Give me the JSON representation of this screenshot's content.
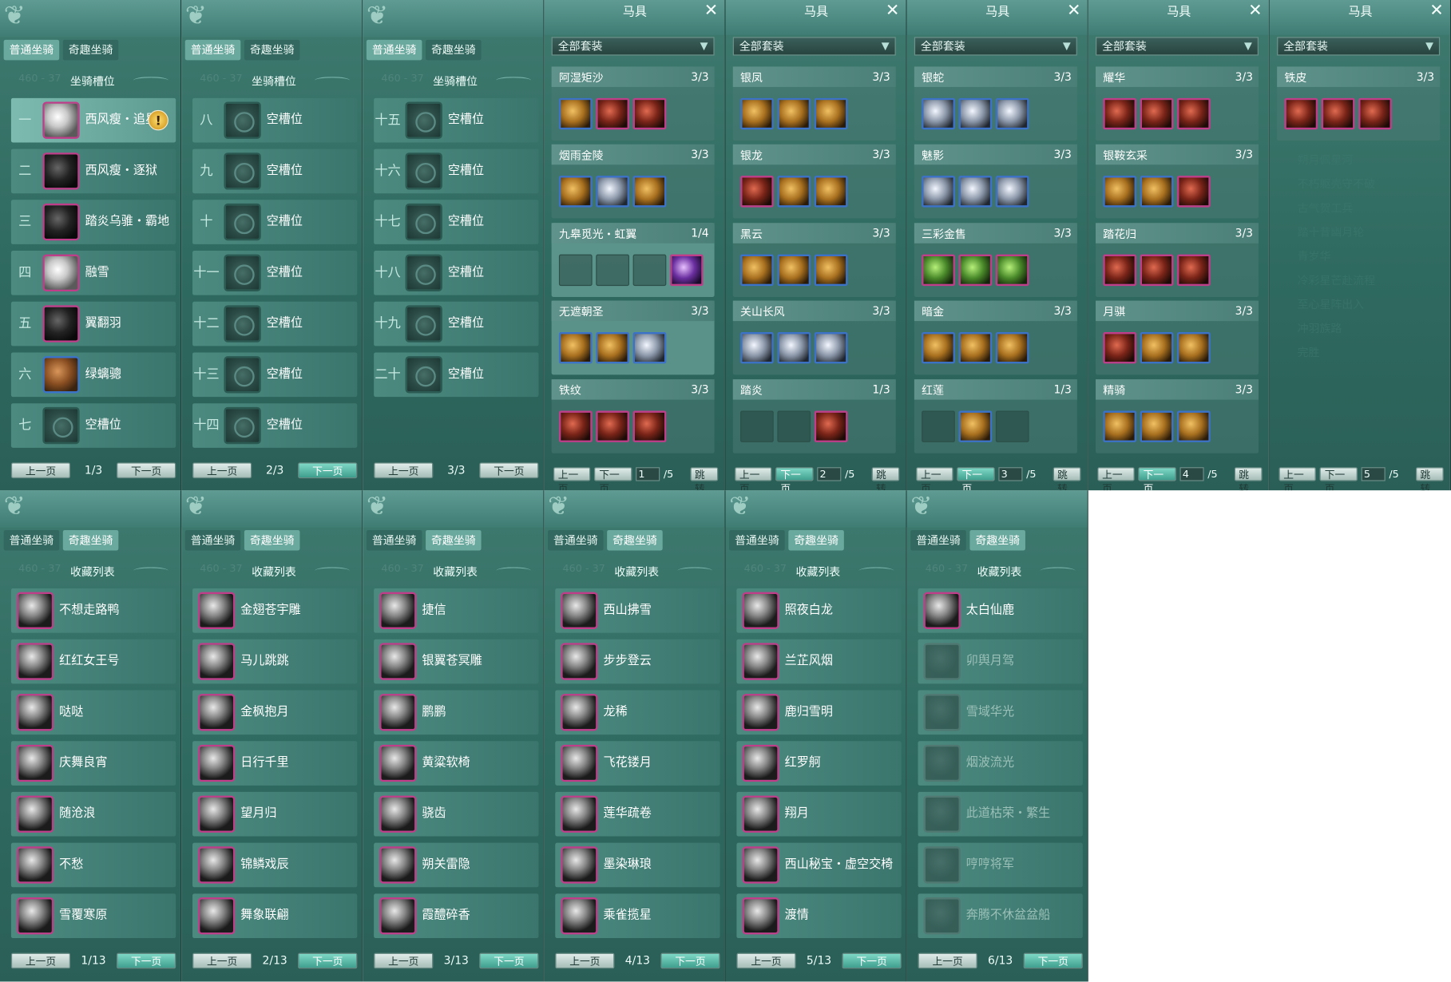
{
  "common": {
    "tab_normal": "普通坐骑",
    "tab_fun": "奇趣坐骑",
    "faint_code": "460 - 37",
    "prev": "上一页",
    "next": "下一页",
    "jump": "跳转"
  },
  "slots_panels": [
    {
      "section": "坐骑槽位",
      "rows": [
        {
          "num": "一",
          "name": "西风瘦・追星",
          "warn": "!"
        },
        {
          "num": "二",
          "name": "西风瘦・逐狱"
        },
        {
          "num": "三",
          "name": "踏炎乌骓・霸地"
        },
        {
          "num": "四",
          "name": "融雪"
        },
        {
          "num": "五",
          "name": "翼翻羽"
        },
        {
          "num": "六",
          "name": "绿螭骢"
        },
        {
          "num": "七",
          "name": "空槽位"
        }
      ],
      "page": "1/3"
    },
    {
      "section": "坐骑槽位",
      "rows": [
        {
          "num": "八",
          "name": "空槽位"
        },
        {
          "num": "九",
          "name": "空槽位"
        },
        {
          "num": "十",
          "name": "空槽位"
        },
        {
          "num": "十一",
          "name": "空槽位"
        },
        {
          "num": "十二",
          "name": "空槽位"
        },
        {
          "num": "十三",
          "name": "空槽位"
        },
        {
          "num": "十四",
          "name": "空槽位"
        }
      ],
      "page": "2/3"
    },
    {
      "section": "坐骑槽位",
      "rows": [
        {
          "num": "十五",
          "name": "空槽位"
        },
        {
          "num": "十六",
          "name": "空槽位"
        },
        {
          "num": "十七",
          "name": "空槽位"
        },
        {
          "num": "十八",
          "name": "空槽位"
        },
        {
          "num": "十九",
          "name": "空槽位"
        },
        {
          "num": "二十",
          "name": "空槽位"
        }
      ],
      "page": "3/3"
    }
  ],
  "gear_panels": [
    {
      "title": "马具",
      "dropdown": "全部套装",
      "page": "1",
      "total": "/5",
      "sets": [
        {
          "name": "阿湿矩沙",
          "count": "3/3"
        },
        {
          "name": "烟雨金陵",
          "count": "3/3"
        },
        {
          "name": "九皋觅光・虹翼",
          "count": "1/4"
        },
        {
          "name": "无遮朝圣",
          "count": "3/3"
        },
        {
          "name": "铁纹",
          "count": "3/3"
        }
      ]
    },
    {
      "title": "马具",
      "dropdown": "全部套装",
      "page": "2",
      "total": "/5",
      "sets": [
        {
          "name": "银凤",
          "count": "3/3"
        },
        {
          "name": "银龙",
          "count": "3/3"
        },
        {
          "name": "黑云",
          "count": "3/3"
        },
        {
          "name": "关山长风",
          "count": "3/3"
        },
        {
          "name": "踏炎",
          "count": "1/3"
        }
      ]
    },
    {
      "title": "马具",
      "dropdown": "全部套装",
      "page": "3",
      "total": "/5",
      "sets": [
        {
          "name": "银蛇",
          "count": "3/3"
        },
        {
          "name": "魅影",
          "count": "3/3"
        },
        {
          "name": "三彩金售",
          "count": "3/3"
        },
        {
          "name": "暗金",
          "count": "3/3"
        },
        {
          "name": "红莲",
          "count": "1/3"
        }
      ]
    },
    {
      "title": "马具",
      "dropdown": "全部套装",
      "page": "4",
      "total": "/5",
      "sets": [
        {
          "name": "耀华",
          "count": "3/3"
        },
        {
          "name": "银鞍玄采",
          "count": "3/3"
        },
        {
          "name": "踏花归",
          "count": "3/3"
        },
        {
          "name": "月骐",
          "count": "3/3"
        },
        {
          "name": "精骑",
          "count": "3/3"
        }
      ]
    },
    {
      "title": "马具",
      "dropdown": "全部套装",
      "page": "5",
      "total": "/5",
      "sets": [
        {
          "name": "铁皮",
          "count": "3/3"
        }
      ],
      "bg_text": [
        "朔月佩星河",
        "不朽躯壳守不破",
        "古气贺工兵",
        "踏十昔幽月轮",
        "青岁华",
        "冷彩星芒赴流程",
        "至心星阵出入",
        "冲羽族路",
        "完胜"
      ]
    }
  ],
  "collection_panels": [
    {
      "section": "收藏列表",
      "page": "1/13",
      "items": [
        "不想走路鸭",
        "红红女王号",
        "哒哒",
        "庆舞良宵",
        "随沧浪",
        "不愁",
        "雪覆寒原"
      ]
    },
    {
      "section": "收藏列表",
      "page": "2/13",
      "items": [
        "金翅苍宇雕",
        "马儿跳跳",
        "金枫抱月",
        "日行千里",
        "望月归",
        "锦鳞戏辰",
        "舞象联翩"
      ]
    },
    {
      "section": "收藏列表",
      "page": "3/13",
      "items": [
        "捷信",
        "银翼苍冥雕",
        "鹏鹏",
        "黄粱软椅",
        "骁齿",
        "朔关雷隐",
        "霞醴碎香"
      ]
    },
    {
      "section": "收藏列表",
      "page": "4/13",
      "items": [
        "西山拂雪",
        "步步登云",
        "龙稀",
        "飞花镂月",
        "莲华疏卷",
        "墨染琳琅",
        "乘雀揽星"
      ]
    },
    {
      "section": "收藏列表",
      "page": "5/13",
      "items": [
        "照夜白龙",
        "兰芷风烟",
        "鹿归雪明",
        "红罗舸",
        "翔月",
        "西山秘宝・虚空交椅",
        "渡情"
      ]
    },
    {
      "section": "收藏列表",
      "page": "6/13",
      "items": [
        "太白仙鹿",
        "卯舆月驾",
        "雪域华光",
        "烟波流光",
        "此道枯荣・繁生",
        "哼哼将军",
        "奔腾不休盆盆船"
      ]
    }
  ]
}
